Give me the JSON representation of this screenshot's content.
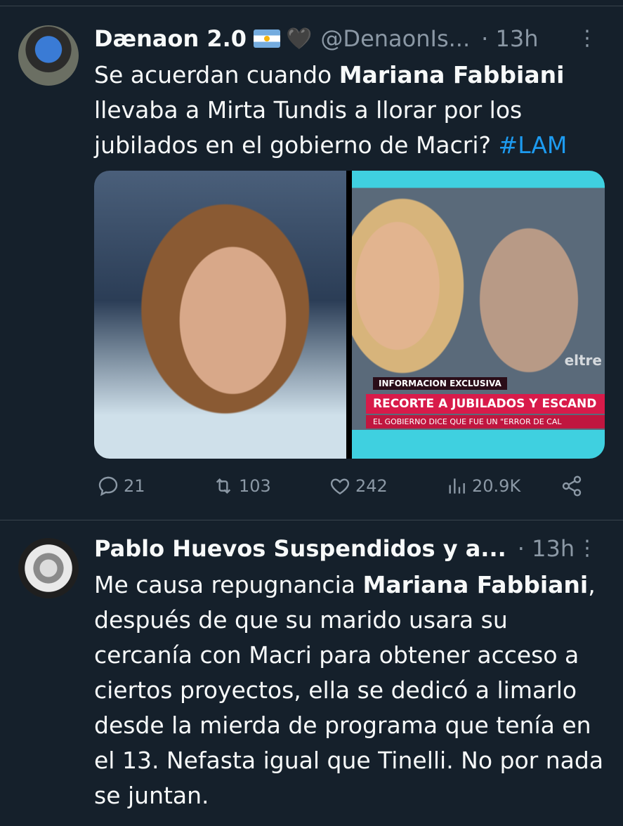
{
  "tweet1": {
    "name": "Dænaon 2.0",
    "handle": "@DenaonIs...",
    "time": "· 13h",
    "text_1": "Se acuerdan cuando ",
    "text_bold": "Mariana Fabbiani",
    "text_2": " llevaba a Mirta Tundis a llorar por los jubilados en el gobierno de Macri? ",
    "hashtag": "#LAM",
    "media": {
      "banner_tag": "INFORMACION EXCLUSIVA",
      "banner_main": "RECORTE A JUBILADOS Y ESCAND",
      "banner_sub": "EL GOBIERNO DICE QUE FUE UN \"ERROR DE CAL",
      "logo": "eltre"
    },
    "actions": {
      "replies": "21",
      "reposts": "103",
      "likes": "242",
      "views": "20.9K"
    }
  },
  "tweet2": {
    "name": "Pablo Huevos Suspendidos y a...",
    "time": "· 13h",
    "text_1": "Me causa repugnancia ",
    "text_bold": "Mariana Fabbiani",
    "text_2": ", después de que su marido usara su cercanía con Macri para obtener acceso a ciertos proyectos, ella se dedicó a limarlo desde la mierda de programa que tenía en el 13. Nefasta igual que Tinelli. No por nada se juntan."
  },
  "icons": [
    "more-icon",
    "reply-icon",
    "repost-icon",
    "like-icon",
    "views-icon",
    "share-icon"
  ],
  "colors": {
    "background": "#15202b",
    "text": "#f7f9f9",
    "muted": "#8b98a5",
    "link": "#1d9bf0",
    "divider": "#38444d"
  }
}
